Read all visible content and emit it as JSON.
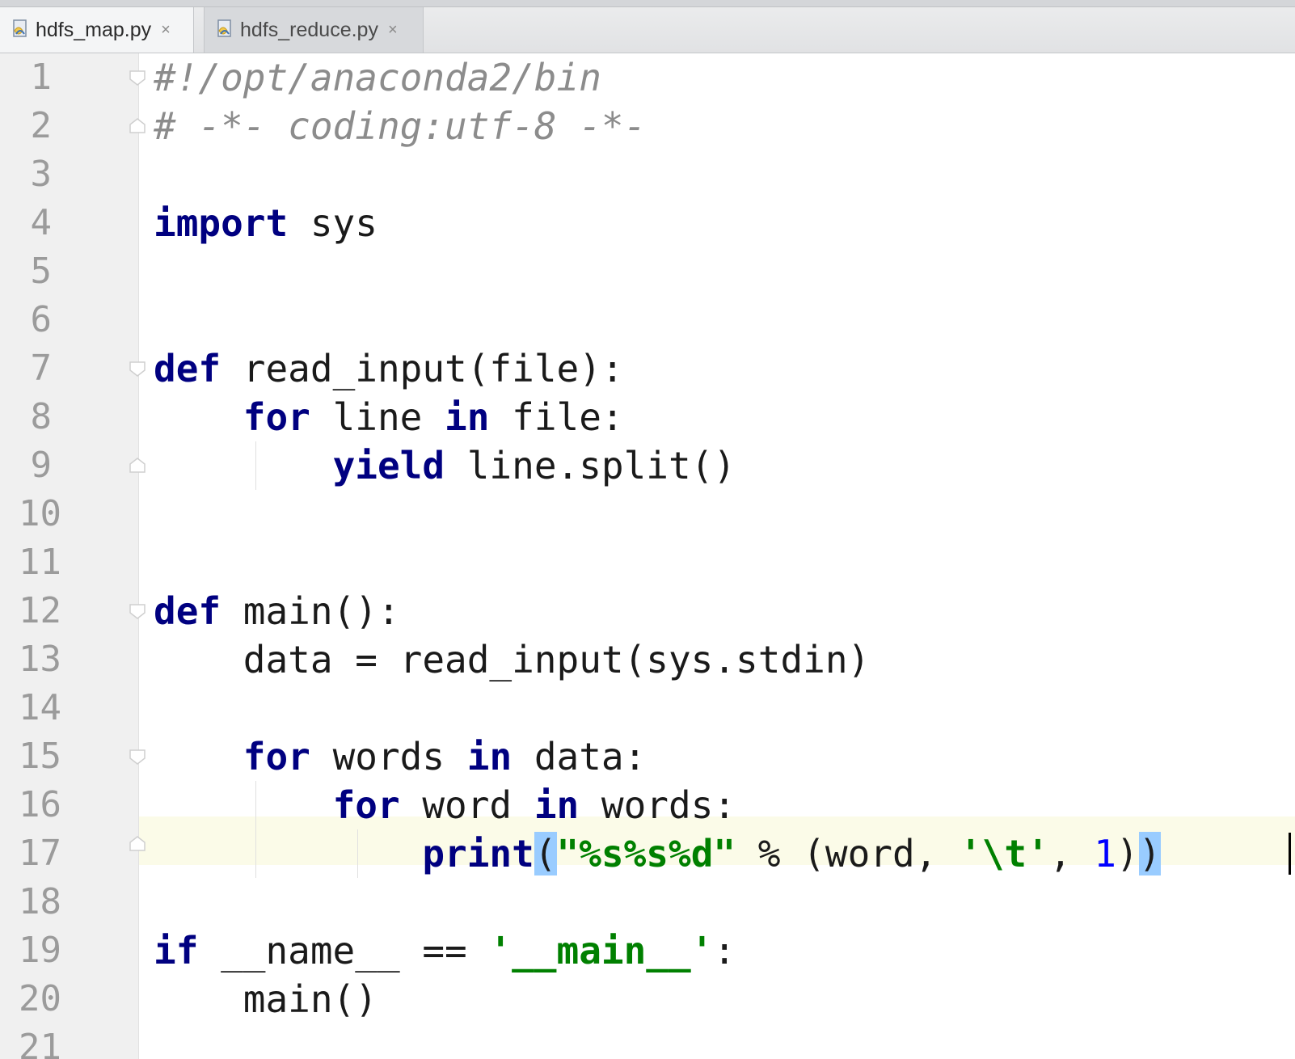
{
  "tabs": [
    {
      "label": "hdfs_map.py",
      "active": true,
      "close": "×",
      "icon": "python-file-icon"
    },
    {
      "label": "hdfs_reduce.py",
      "active": false,
      "close": "×",
      "icon": "python-file-icon"
    }
  ],
  "editor": {
    "line_numbers": [
      "1",
      "2",
      "3",
      "4",
      "5",
      "6",
      "7",
      "8",
      "9",
      "10",
      "11",
      "12",
      "13",
      "14",
      "15",
      "16",
      "17",
      "18",
      "19",
      "20",
      "21"
    ],
    "current_line": "17",
    "lines": {
      "l1": {
        "comment": "#!/opt/anaconda2/bin"
      },
      "l2": {
        "comment": "# -*- coding:utf-8 -*-"
      },
      "l4": {
        "kw": "import",
        "rest": " sys"
      },
      "l7": {
        "kw": "def",
        "rest": " read_input(file):"
      },
      "l8": {
        "indent": "    ",
        "kw1": "for",
        "mid": " line ",
        "kw2": "in",
        "rest": " file:"
      },
      "l9": {
        "indent": "        ",
        "kw": "yield",
        "rest": " line.split()"
      },
      "l12": {
        "kw": "def",
        "rest": " main():"
      },
      "l13": {
        "indent": "    ",
        "rest": "data = read_input(sys.stdin)"
      },
      "l15": {
        "indent": "    ",
        "kw1": "for",
        "mid": " words ",
        "kw2": "in",
        "rest": " data:"
      },
      "l16": {
        "indent": "        ",
        "kw1": "for",
        "mid": " word ",
        "kw2": "in",
        "rest": " words:"
      },
      "l17": {
        "indent": "            ",
        "kw": "print",
        "open": "(",
        "str1": "\"%s%s%d\"",
        "mid": " % (word, ",
        "str2": "'\\t'",
        "sep": ", ",
        "num": "1",
        "inner_close": ")",
        "close": ")"
      },
      "l19": {
        "kw": "if",
        "mid": " __name__ == ",
        "str": "'__main__'",
        "rest": ":"
      },
      "l20": {
        "indent": "    ",
        "rest": "main()"
      }
    }
  },
  "colors": {
    "keyword": "#000080",
    "string": "#008000",
    "number": "#0000ff",
    "comment": "#8c8c8c",
    "brace_highlight": "#99ccff",
    "caret_row": "#fbfbe8",
    "gutter": "#f0f0f0"
  }
}
